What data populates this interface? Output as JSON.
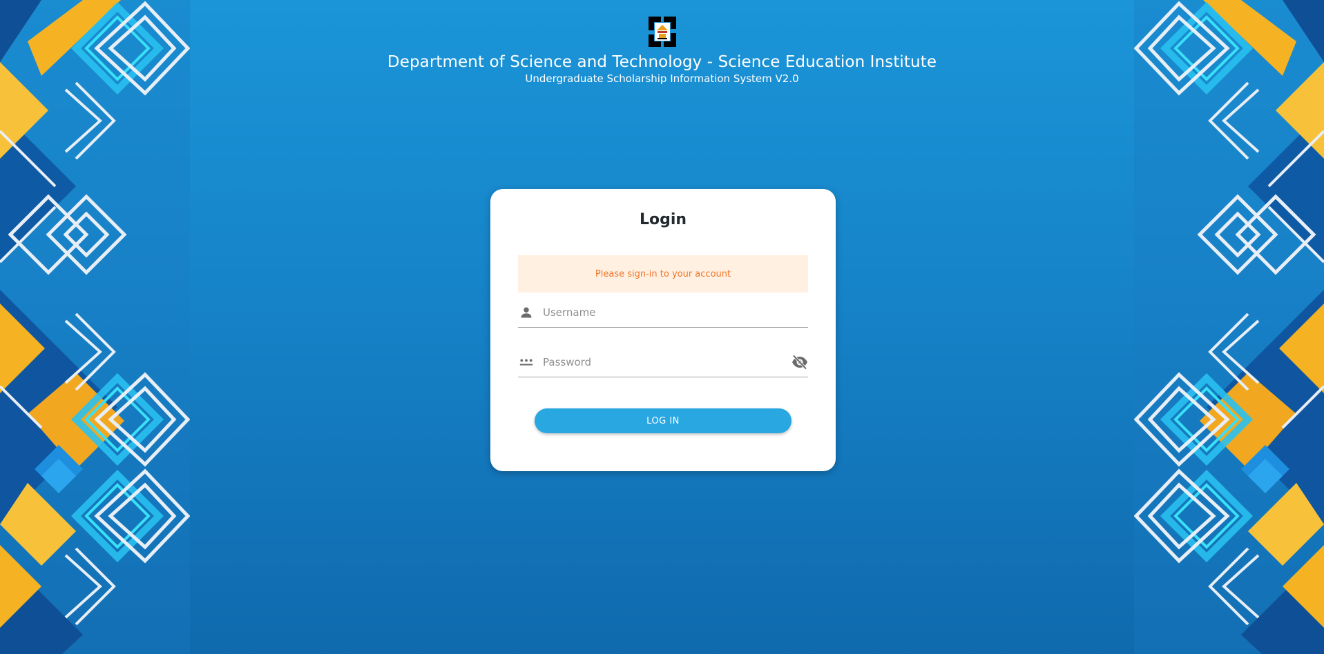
{
  "header": {
    "title": "Department of Science and Technology - Science Education Institute",
    "subtitle": "Undergraduate Scholarship Information System V2.0",
    "logo_icon": "dost-sei-logo"
  },
  "login": {
    "title": "Login",
    "alert": "Please sign-in to your account",
    "username": {
      "placeholder": "Username",
      "value": "",
      "icon": "person-icon"
    },
    "password": {
      "placeholder": "Password",
      "value": "",
      "icon": "password-dots-icon",
      "toggle_icon": "eye-off-icon"
    },
    "button_label": "LOG IN"
  },
  "colors": {
    "background_top": "#1b95d8",
    "background_bottom": "#1069ad",
    "alert_bg": "#fff0e1",
    "alert_text": "#f0762a",
    "button": "#29a7e1",
    "pattern_gold": "#f5b324",
    "pattern_cyan": "#22d4f2"
  }
}
